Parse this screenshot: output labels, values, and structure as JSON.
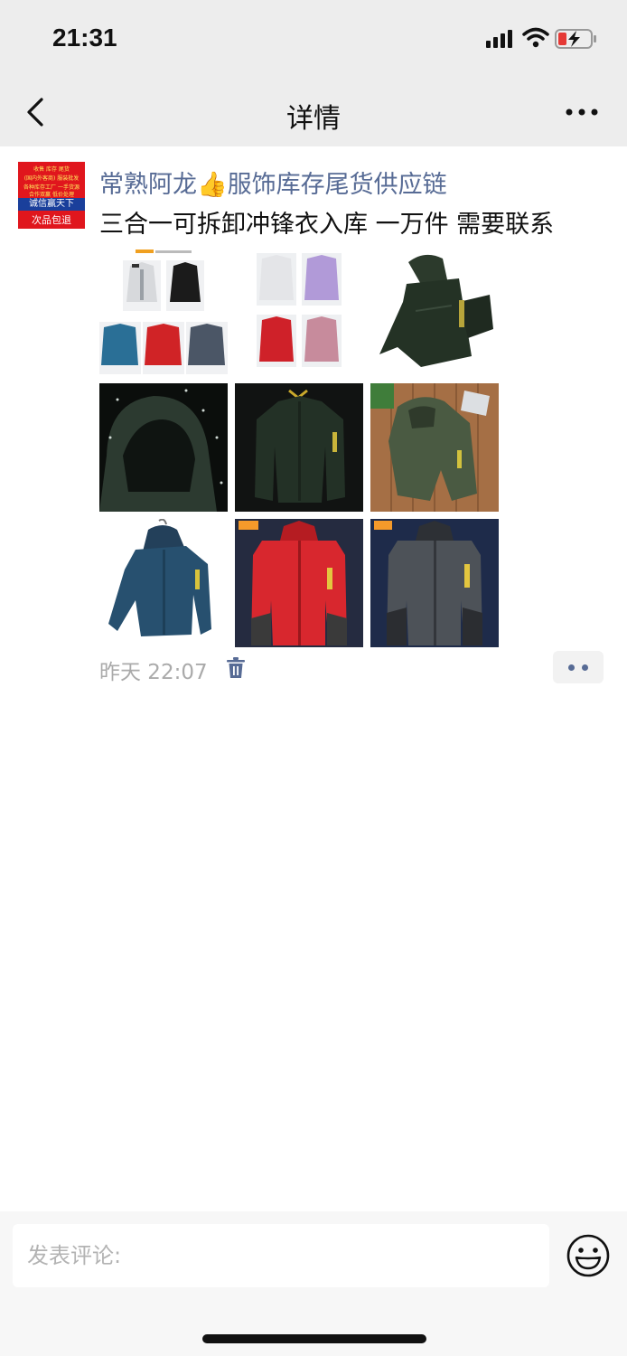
{
  "status_bar": {
    "time": "21:31"
  },
  "nav": {
    "title": "详情"
  },
  "post": {
    "avatar": {
      "lines": [
        "收售 库存 尾货",
        "(国内外客商) 服装批发",
        "各种库存工厂 一手货源",
        "合作双赢 低价处理"
      ],
      "slogan1": "诚信赢天下",
      "slogan2": "次品包退"
    },
    "author_name": "常熟阿龙",
    "author_emoji": "👍",
    "author_suffix": "服饰库存尾货供应链",
    "text": "三合一可拆卸冲锋衣入库 一万件 需要联系",
    "images": [
      "color-variants-collage-6",
      "color-variants-collage-4",
      "dark-green-jacket-side",
      "hood-rain-closeup",
      "dark-green-jacket-front",
      "olive-jacket-on-floor",
      "blue-jacket-hanging",
      "red-jacket-front",
      "grey-jacket-front"
    ],
    "time": "昨天 22:07",
    "colors": {
      "link": "#576b95"
    }
  },
  "comment": {
    "placeholder": "发表评论:"
  }
}
